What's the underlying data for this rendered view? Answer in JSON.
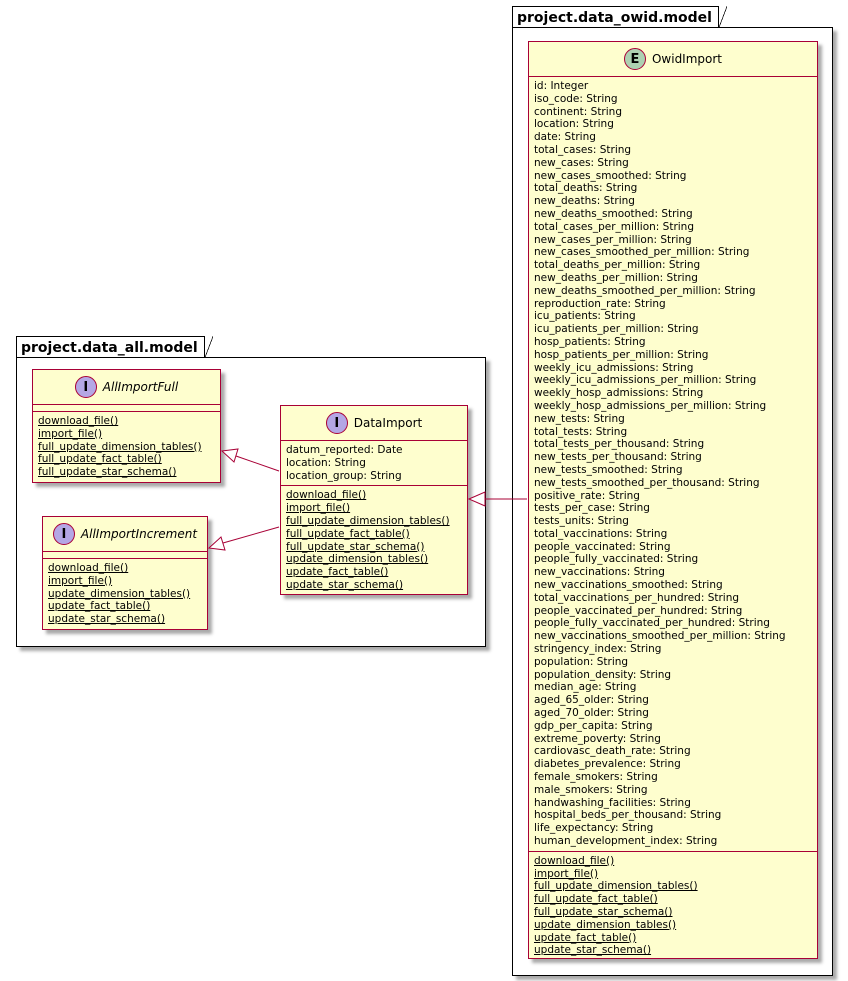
{
  "packages": [
    {
      "id": "owid",
      "name": "project.data_owid.model"
    },
    {
      "id": "all",
      "name": "project.data_all.model"
    }
  ],
  "classes": {
    "owid_import": {
      "stereotype": "E",
      "name": "OwidImport",
      "attributes": [
        "id: Integer",
        "iso_code:  String",
        "continent:  String",
        "location:  String",
        "date:  String",
        "total_cases:  String",
        "new_cases:  String",
        "new_cases_smoothed:  String",
        "total_deaths:  String",
        "new_deaths:  String",
        "new_deaths_smoothed:  String",
        "total_cases_per_million:  String",
        "new_cases_per_million:  String",
        "new_cases_smoothed_per_million:  String",
        "total_deaths_per_million:  String",
        "new_deaths_per_million:  String",
        "new_deaths_smoothed_per_million:  String",
        "reproduction_rate:  String",
        "icu_patients:  String",
        "icu_patients_per_million:  String",
        "hosp_patients:  String",
        "hosp_patients_per_million:  String",
        "weekly_icu_admissions:  String",
        "weekly_icu_admissions_per_million:  String",
        "weekly_hosp_admissions:  String",
        "weekly_hosp_admissions_per_million:  String",
        "new_tests:  String",
        "total_tests:  String",
        "total_tests_per_thousand:  String",
        "new_tests_per_thousand:  String",
        "new_tests_smoothed:  String",
        "new_tests_smoothed_per_thousand:  String",
        "positive_rate:  String",
        "tests_per_case:  String",
        "tests_units:  String",
        "total_vaccinations:  String",
        "people_vaccinated:  String",
        "people_fully_vaccinated:  String",
        "new_vaccinations:  String",
        "new_vaccinations_smoothed:  String",
        "total_vaccinations_per_hundred:  String",
        "people_vaccinated_per_hundred:  String",
        "people_fully_vaccinated_per_hundred:  String",
        "new_vaccinations_smoothed_per_million:  String",
        "stringency_index:  String",
        "population:  String",
        "population_density:  String",
        "median_age:  String",
        "aged_65_older:  String",
        "aged_70_older:  String",
        "gdp_per_capita:  String",
        "extreme_poverty:  String",
        "cardiovasc_death_rate:  String",
        "diabetes_prevalence:  String",
        "female_smokers:  String",
        "male_smokers:  String",
        "handwashing_facilities:  String",
        "hospital_beds_per_thousand:  String",
        "life_expectancy:  String",
        "human_development_index:  String"
      ],
      "methods": [
        "download_file()",
        "import_file()",
        "full_update_dimension_tables()",
        "full_update_fact_table()",
        "full_update_star_schema()",
        "update_dimension_tables()",
        "update_fact_table()",
        "update_star_schema()"
      ]
    },
    "data_import": {
      "stereotype": "I",
      "name": "DataImport",
      "attributes": [
        "datum_reported: Date",
        "location: String",
        "location_group: String"
      ],
      "methods": [
        "download_file()",
        "import_file()",
        "full_update_dimension_tables()",
        "full_update_fact_table()",
        "full_update_star_schema()",
        "update_dimension_tables()",
        "update_fact_table()",
        "update_star_schema()"
      ]
    },
    "all_import_full": {
      "stereotype": "I",
      "name": "AllImportFull",
      "attributes": [],
      "methods": [
        "download_file()",
        "import_file()",
        "full_update_dimension_tables()",
        "full_update_fact_table()",
        "full_update_star_schema()"
      ]
    },
    "all_import_increment": {
      "stereotype": "I",
      "name": "AllImportIncrement",
      "attributes": [],
      "methods": [
        "download_file()",
        "import_file()",
        "update_dimension_tables()",
        "update_fact_table()",
        "update_star_schema()"
      ]
    }
  },
  "colors": {
    "class_fill": "#fefece",
    "class_border": "#a80036",
    "interface_badge": "#b4a7e5",
    "entity_badge": "#add1b2"
  }
}
